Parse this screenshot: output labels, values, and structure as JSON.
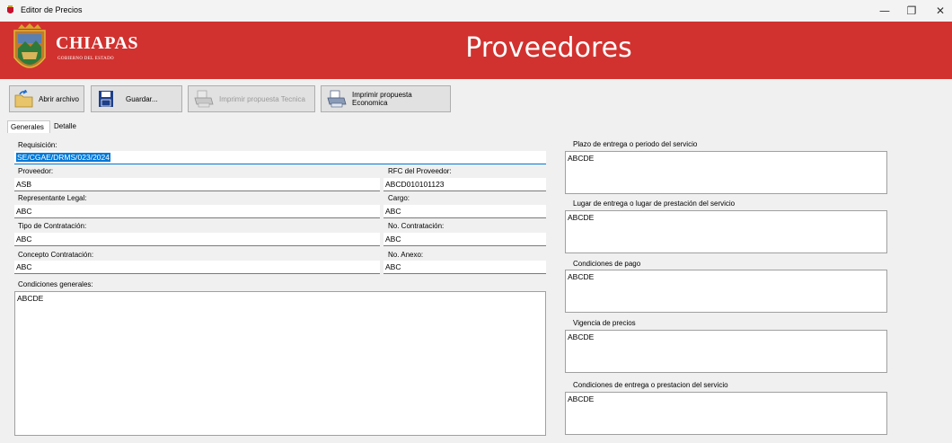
{
  "window": {
    "title": "Editor de Precios",
    "minimize": "—",
    "maximize": "❐",
    "close": "✕"
  },
  "banner": {
    "logo_name": "CHIAPAS",
    "logo_subtitle": "GOBIERNO DEL ESTADO",
    "title": "Proveedores",
    "color": "#d1322f"
  },
  "toolbar": {
    "open_label": "Abrir archivo",
    "save_label": "Guardar...",
    "print_technical_label": "Imprimir propuesta Tecnica",
    "print_economic_label": "Imprimir propuesta Economica"
  },
  "tabs": [
    {
      "label": "Generales",
      "active": true
    },
    {
      "label": "Detalle",
      "active": false
    }
  ],
  "form": {
    "requisicion_label": "Requisición:",
    "requisicion_value": "SE/CGAE/DRMS/023/2024",
    "proveedor_label": "Proveedor:",
    "proveedor_value": "ASB",
    "rfc_label": "RFC del Proveedor:",
    "rfc_value": "ABCD010101123",
    "representante_label": "Representante Legal:",
    "representante_value": "ABC",
    "cargo_label": "Cargo:",
    "cargo_value": "ABC",
    "tipo_label": "Tipo de Contratación:",
    "tipo_value": "ABC",
    "no_contratacion_label": "No. Contratación:",
    "no_contratacion_value": "ABC",
    "concepto_label": "Concepto Contratación:",
    "concepto_value": "ABC",
    "no_anexo_label": "No. Anexo:",
    "no_anexo_value": "ABC",
    "condiciones_generales_label": "Condiciones generales:",
    "condiciones_generales_value": "ABCDE"
  },
  "right": {
    "plazo_label": "Plazo de entrega  o periodo del servicio",
    "plazo_value": "ABCDE",
    "lugar_label": "Lugar de entrega o lugar de prestación del servicio",
    "lugar_value": "ABCDE",
    "pago_label": "Condiciones de pago",
    "pago_value": "ABCDE",
    "vigencia_label": "Vigencia de precios",
    "vigencia_value": "ABCDE",
    "entrega_label": "Condiciones de entrega o prestacion del servicio",
    "entrega_value": "ABCDE"
  }
}
